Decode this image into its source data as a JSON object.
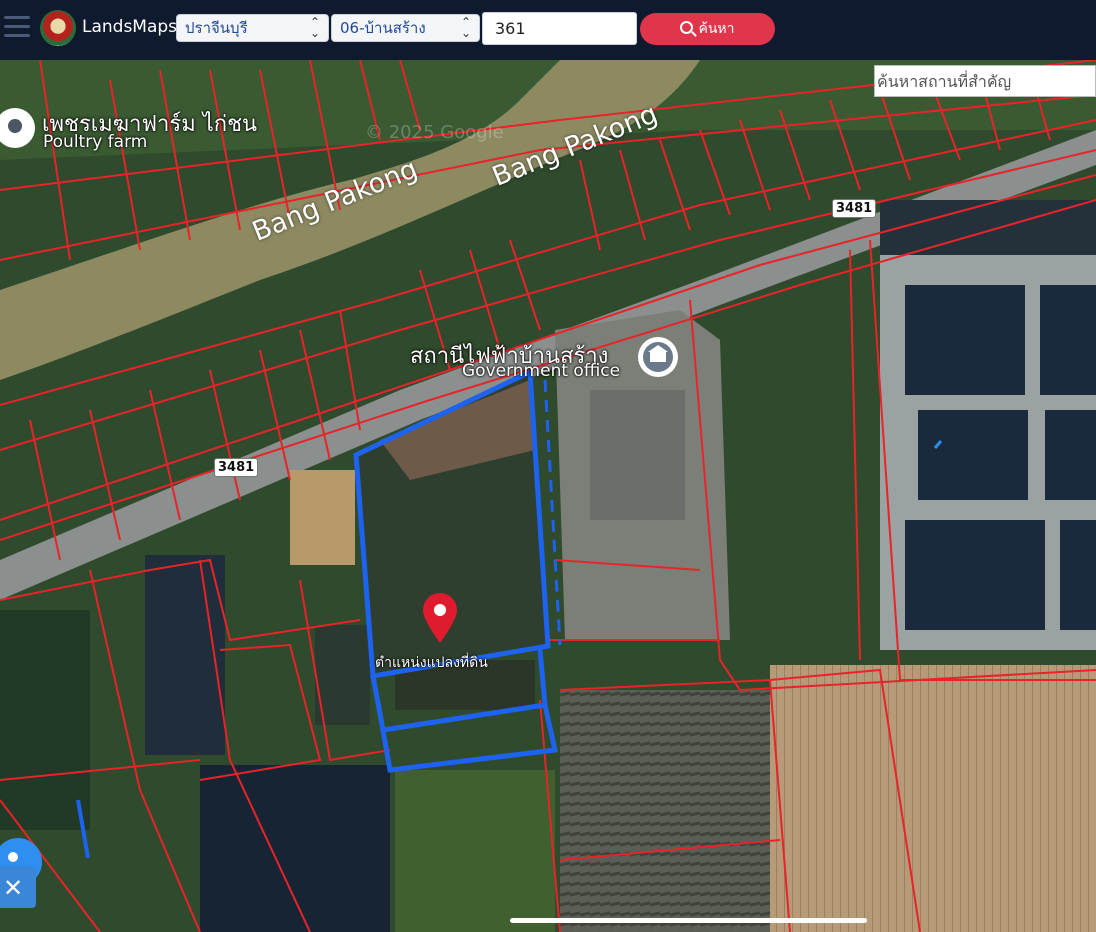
{
  "header": {
    "app_title": "LandsMaps",
    "province_select": "ปราจีนบุรี",
    "district_select": "06-บ้านสร้าง",
    "parcel_number": "361",
    "search_button": "ค้นหา"
  },
  "map": {
    "place_search_placeholder": "ค้นหาสถานที่สำคัญ",
    "river_labels": [
      "Bang Pakong",
      "Bang Pakong"
    ],
    "poi_poultry": {
      "title": "เพชรเมฆาฟาร์ม ไก่ชน",
      "subtitle": "Poultry farm"
    },
    "poi_government": {
      "title": "สถานีไฟฟ้าบ้านสร้าง",
      "subtitle": "Government office"
    },
    "road_shields": [
      "3481",
      "3481"
    ],
    "parcel_marker_label": "ตำแหน่งแปลงที่ดิน",
    "watermark": "© 2025 Google"
  },
  "colors": {
    "topbar": "#0f1a2e",
    "search_button": "#e0354a",
    "parcel_lines": "#e8232a",
    "selected_parcel": "#1e63f0",
    "marker": "#e01b2e"
  }
}
